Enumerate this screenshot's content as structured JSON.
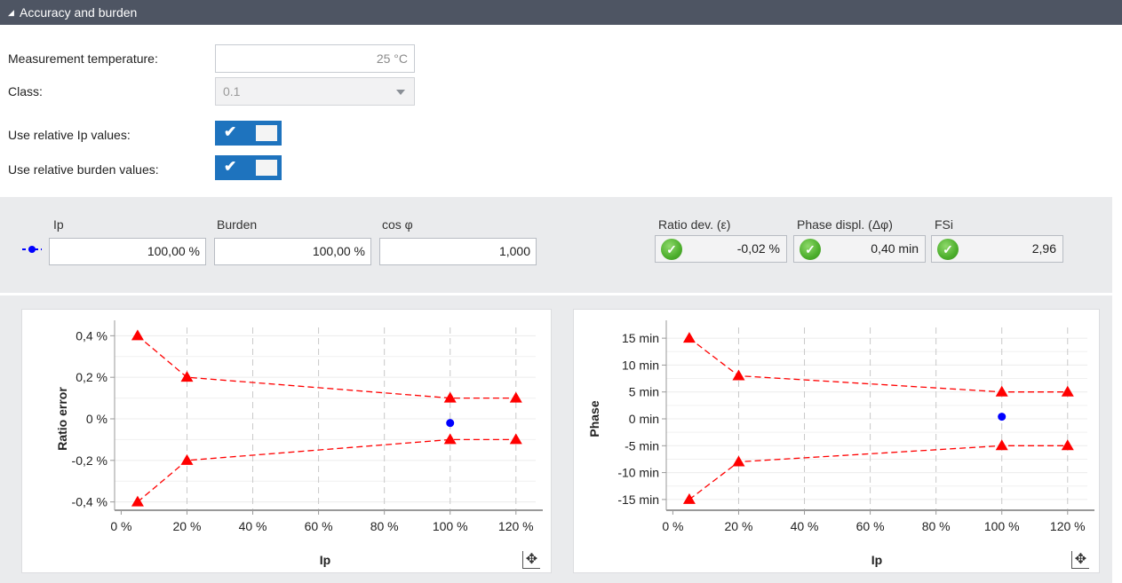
{
  "section": {
    "title": "Accuracy and burden"
  },
  "settings": {
    "measurement_temperature_label": "Measurement temperature:",
    "measurement_temperature_value": "25 °C",
    "class_label": "Class:",
    "class_value": "0.1",
    "relative_ip_label": "Use relative Ip values:",
    "relative_ip_on": true,
    "relative_burden_label": "Use relative burden values:",
    "relative_burden_on": true
  },
  "inputs": {
    "ip_header": "Ip",
    "ip_value": "100,00 %",
    "burden_header": "Burden",
    "burden_value": "100,00 %",
    "cosphi_header": "cos φ",
    "cosphi_value": "1,000"
  },
  "results": {
    "ratio_header": "Ratio dev. (ε)",
    "ratio_value": "-0,02 %",
    "phase_header": "Phase displ. (Δφ)",
    "phase_value": "0,40 min",
    "fsi_header": "FSi",
    "fsi_value": "2,96",
    "status_icon": "check-circle-icon"
  },
  "colors": {
    "limit": "#ff0000",
    "measured": "#0000ff",
    "accent": "#1e73be",
    "header_bg": "#4e5563"
  },
  "chart_data": [
    {
      "type": "line",
      "xlabel": "Ip",
      "ylabel": "Ratio error",
      "xlim": [
        -2,
        126
      ],
      "ylim": [
        -0.44,
        0.44
      ],
      "xticks": [
        0,
        20,
        40,
        60,
        80,
        100,
        120
      ],
      "xtick_labels": [
        "0 %",
        "20 %",
        "40 %",
        "60 %",
        "80 %",
        "100 %",
        "120 %"
      ],
      "yticks": [
        0.4,
        0.2,
        0,
        -0.2,
        -0.4
      ],
      "ytick_labels": [
        "0,4 %",
        "0,2 %",
        "0 %",
        "-0,2 %",
        "-0,4 %"
      ],
      "grid": true,
      "series": [
        {
          "x": [
            5,
            20,
            100,
            120
          ],
          "values": [
            0.4,
            0.2,
            0.1,
            0.1
          ],
          "style": "limit"
        },
        {
          "x": [
            5,
            20,
            100,
            120
          ],
          "values": [
            -0.4,
            -0.2,
            -0.1,
            -0.1
          ],
          "style": "limit"
        },
        {
          "x": [
            100
          ],
          "values": [
            -0.02
          ],
          "style": "measured"
        }
      ]
    },
    {
      "type": "line",
      "xlabel": "Ip",
      "ylabel": "Phase",
      "xlim": [
        -2,
        126
      ],
      "ylim": [
        -17,
        17
      ],
      "xticks": [
        0,
        20,
        40,
        60,
        80,
        100,
        120
      ],
      "xtick_labels": [
        "0 %",
        "20 %",
        "40 %",
        "60 %",
        "80 %",
        "100 %",
        "120 %"
      ],
      "yticks": [
        15,
        10,
        5,
        0,
        -5,
        -10,
        -15
      ],
      "ytick_labels": [
        "15 min",
        "10 min",
        "5 min",
        "0 min",
        "-5 min",
        "-10 min",
        "-15 min"
      ],
      "grid": true,
      "series": [
        {
          "x": [
            5,
            20,
            100,
            120
          ],
          "values": [
            15,
            8,
            5,
            5
          ],
          "style": "limit"
        },
        {
          "x": [
            5,
            20,
            100,
            120
          ],
          "values": [
            -15,
            -8,
            -5,
            -5
          ],
          "style": "limit"
        },
        {
          "x": [
            100
          ],
          "values": [
            0.4
          ],
          "style": "measured"
        }
      ]
    }
  ]
}
